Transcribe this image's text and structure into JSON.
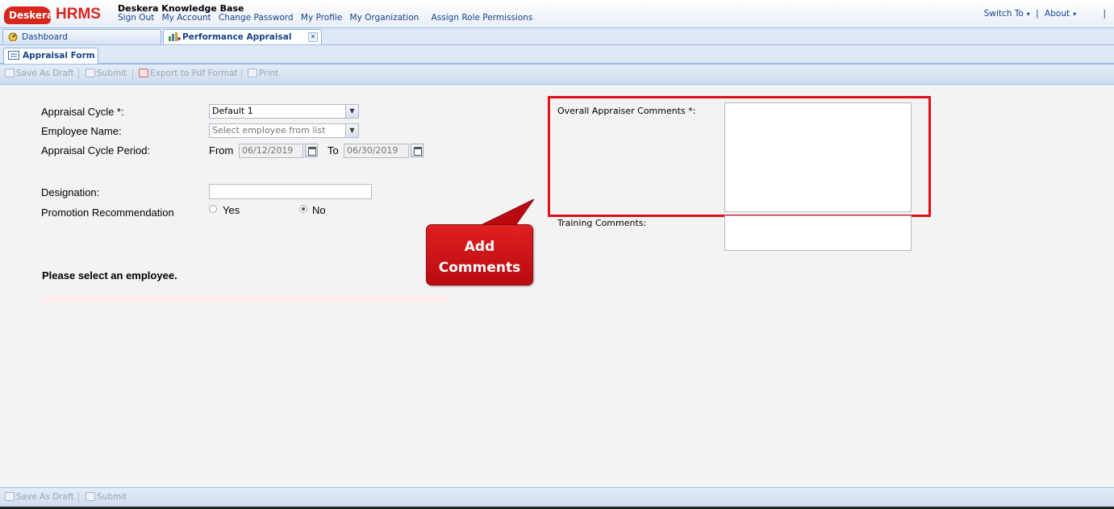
{
  "header": {
    "logo_text": "Deskera",
    "product": "HRMS",
    "kb_title": "Deskera Knowledge Base",
    "links": [
      "Sign Out",
      "My Account",
      "Change Password",
      "My Profile",
      "My Organization",
      "Assign Role Permissions"
    ],
    "switch_to": "Switch To",
    "about": "About",
    "separator": "|"
  },
  "tabs": [
    {
      "label": "Dashboard",
      "active": false
    },
    {
      "label": "Performance Appraisal",
      "active": true,
      "closable": true
    }
  ],
  "subtab": {
    "label": "Appraisal Form"
  },
  "toolbar_top": {
    "save_draft": "Save As Draft",
    "submit": "Submit",
    "export_pdf": "Export to Pdf Format",
    "print": "Print"
  },
  "toolbar_bottom": {
    "save_draft": "Save As Draft",
    "submit": "Submit"
  },
  "form": {
    "appraisal_cycle_label": "Appraisal Cycle *:",
    "appraisal_cycle_value": "Default 1",
    "employee_name_label": "Employee Name:",
    "employee_name_placeholder": "Select employee from list",
    "cycle_period_label": "Appraisal Cycle Period:",
    "from_label": "From",
    "from_value": "06/12/2019",
    "to_label": "To",
    "to_value": "06/30/2019",
    "designation_label": "Designation:",
    "designation_value": "",
    "promotion_label": "Promotion Recommendation",
    "promotion_options": [
      {
        "label": "Yes",
        "selected": false
      },
      {
        "label": "No",
        "selected": true
      }
    ],
    "message": "Please select an employee.",
    "overall_comments_label": "Overall Appraiser Comments *:",
    "training_comments_label": "Training Comments:"
  },
  "callout": {
    "line1": "Add",
    "line2": "Comments"
  },
  "colors": {
    "brand_red": "#d9261c",
    "highlight_red": "#e0101a",
    "link_blue": "#15428b"
  },
  "icons": [
    "cloud-logo-icon",
    "dashboard-icon",
    "performance-icon",
    "close-icon",
    "form-icon",
    "save-draft-icon",
    "submit-icon",
    "pdf-icon",
    "print-icon",
    "dropdown-icon",
    "calendar-icon"
  ]
}
